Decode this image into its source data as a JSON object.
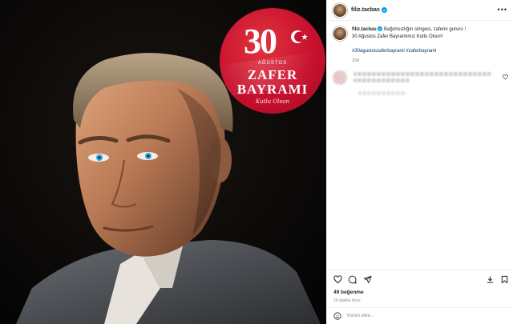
{
  "post": {
    "username": "filiz.tacbas",
    "verified": true,
    "caption_text": "Bağımsızlığın simgesi, zaferin gururu !",
    "caption_line2": "30 Ağustos Zafer Bayramımız Kutlu Olsun!",
    "hashtags": "#30agustoszaferbayrami #zaferbayrami",
    "age": "29d",
    "likes": "49 beğenme",
    "time_ago": "29 dakika önce",
    "comment_placeholder": "Yorum ekle..."
  },
  "badge": {
    "number": "30",
    "month": "AĞUSTOS",
    "line1": "ZAFER",
    "line2": "BAYRAMI",
    "script": "Kutlu Olsun"
  },
  "icons": {
    "verified": "verified-badge-icon",
    "more": "more-options-icon",
    "like": "heart-icon",
    "comment": "comment-icon",
    "share": "share-icon",
    "save": "bookmark-icon",
    "emoji": "emoji-icon"
  },
  "colors": {
    "badge_red": "#c8102e",
    "verified_blue": "#0095f6",
    "hashtag": "#00376b",
    "muted": "#8e8e8e"
  }
}
